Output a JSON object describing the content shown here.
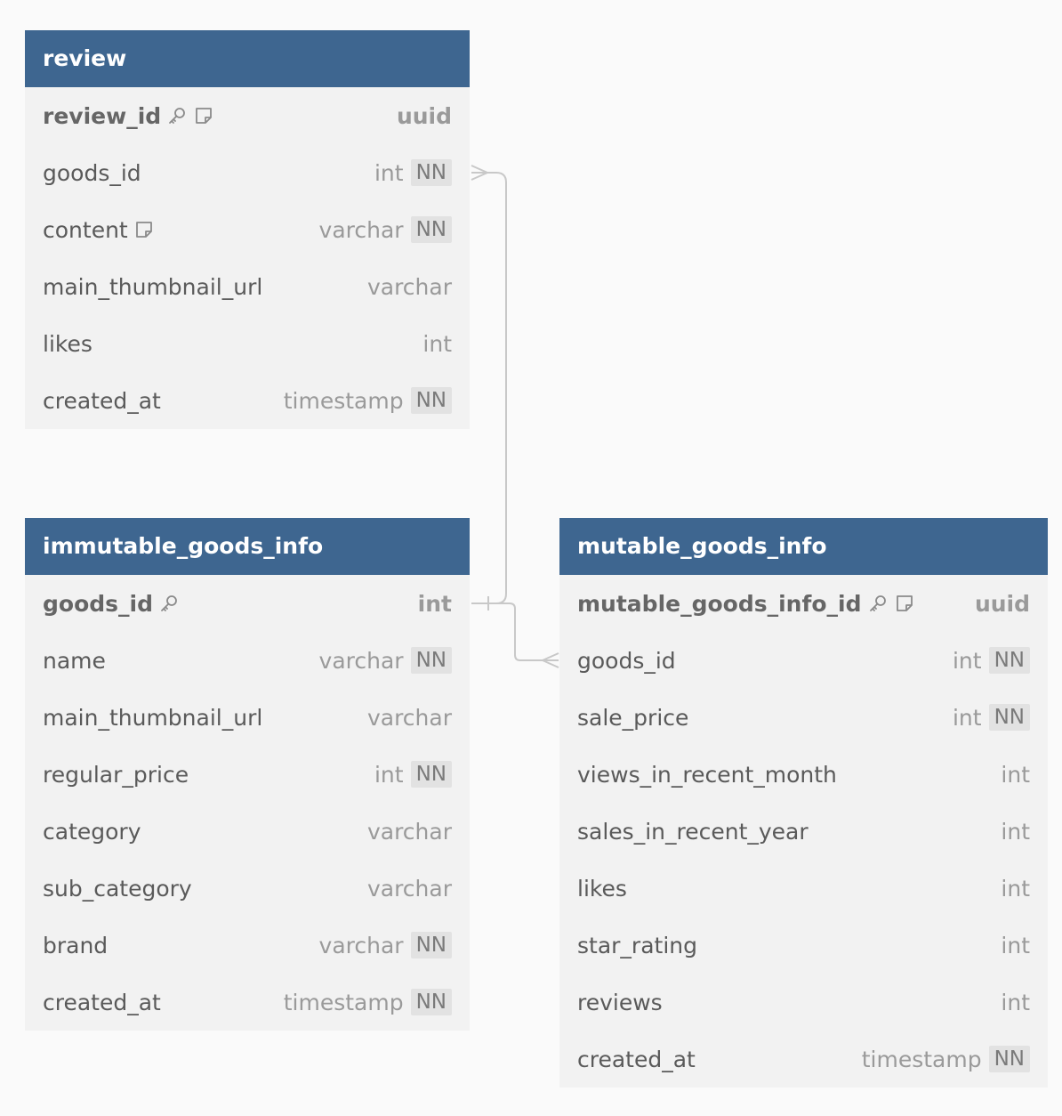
{
  "colors": {
    "header_bg": "#3e6690",
    "table_bg": "#f2f2f2",
    "connector": "#c8c8c8",
    "nn_badge_bg": "#e2e2e2"
  },
  "tables": {
    "review": {
      "name": "review",
      "columns": [
        {
          "name": "review_id",
          "type": "uuid",
          "pk": true,
          "icons": [
            "key-icon",
            "note-icon"
          ],
          "nn": ""
        },
        {
          "name": "goods_id",
          "type": "int",
          "nn": "NN"
        },
        {
          "name": "content",
          "type": "varchar",
          "icons": [
            "note-icon"
          ],
          "nn": "NN"
        },
        {
          "name": "main_thumbnail_url",
          "type": "varchar",
          "nn": ""
        },
        {
          "name": "likes",
          "type": "int",
          "nn": ""
        },
        {
          "name": "created_at",
          "type": "timestamp",
          "nn": "NN"
        }
      ]
    },
    "immutable_goods_info": {
      "name": "immutable_goods_info",
      "columns": [
        {
          "name": "goods_id",
          "type": "int",
          "pk": true,
          "icons": [
            "key-icon"
          ],
          "nn": ""
        },
        {
          "name": "name",
          "type": "varchar",
          "nn": "NN"
        },
        {
          "name": "main_thumbnail_url",
          "type": "varchar",
          "nn": ""
        },
        {
          "name": "regular_price",
          "type": "int",
          "nn": "NN"
        },
        {
          "name": "category",
          "type": "varchar",
          "nn": ""
        },
        {
          "name": "sub_category",
          "type": "varchar",
          "nn": ""
        },
        {
          "name": "brand",
          "type": "varchar",
          "nn": "NN"
        },
        {
          "name": "created_at",
          "type": "timestamp",
          "nn": "NN"
        }
      ]
    },
    "mutable_goods_info": {
      "name": "mutable_goods_info",
      "columns": [
        {
          "name": "mutable_goods_info_id",
          "type": "uuid",
          "pk": true,
          "icons": [
            "key-icon",
            "note-icon"
          ],
          "nn": ""
        },
        {
          "name": "goods_id",
          "type": "int",
          "nn": "NN"
        },
        {
          "name": "sale_price",
          "type": "int",
          "nn": "NN"
        },
        {
          "name": "views_in_recent_month",
          "type": "int",
          "nn": ""
        },
        {
          "name": "sales_in_recent_year",
          "type": "int",
          "nn": ""
        },
        {
          "name": "likes",
          "type": "int",
          "nn": ""
        },
        {
          "name": "star_rating",
          "type": "int",
          "nn": ""
        },
        {
          "name": "reviews",
          "type": "int",
          "nn": ""
        },
        {
          "name": "created_at",
          "type": "timestamp",
          "nn": "NN"
        }
      ]
    }
  },
  "relationships": [
    {
      "from": "immutable_goods_info.goods_id",
      "to": "review.goods_id",
      "type": "one-to-many"
    },
    {
      "from": "immutable_goods_info.goods_id",
      "to": "mutable_goods_info.goods_id",
      "type": "one-to-many"
    }
  ]
}
